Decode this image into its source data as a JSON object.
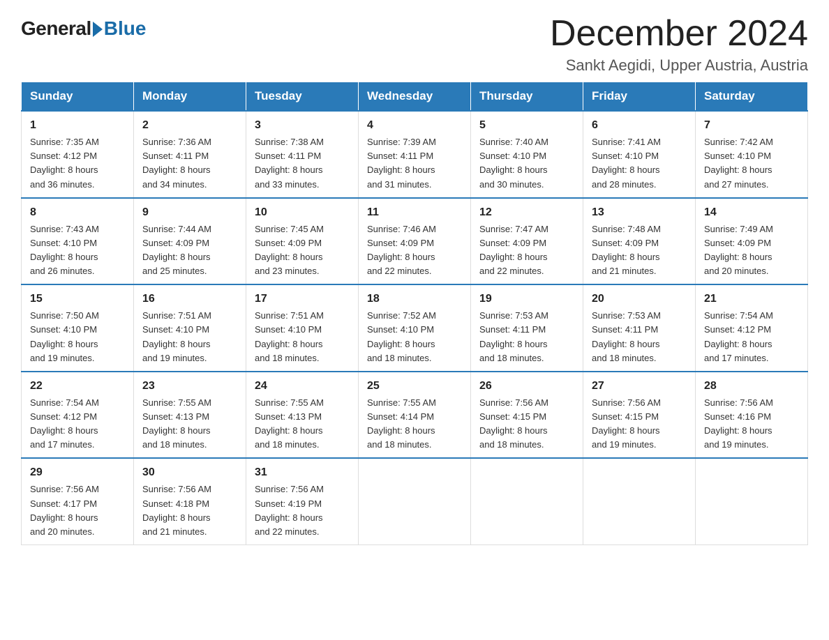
{
  "logo": {
    "general": "General",
    "blue": "Blue"
  },
  "title": "December 2024",
  "subtitle": "Sankt Aegidi, Upper Austria, Austria",
  "days_of_week": [
    "Sunday",
    "Monday",
    "Tuesday",
    "Wednesday",
    "Thursday",
    "Friday",
    "Saturday"
  ],
  "weeks": [
    [
      {
        "day": 1,
        "sunrise": "7:35 AM",
        "sunset": "4:12 PM",
        "daylight": "8 hours and 36 minutes."
      },
      {
        "day": 2,
        "sunrise": "7:36 AM",
        "sunset": "4:11 PM",
        "daylight": "8 hours and 34 minutes."
      },
      {
        "day": 3,
        "sunrise": "7:38 AM",
        "sunset": "4:11 PM",
        "daylight": "8 hours and 33 minutes."
      },
      {
        "day": 4,
        "sunrise": "7:39 AM",
        "sunset": "4:11 PM",
        "daylight": "8 hours and 31 minutes."
      },
      {
        "day": 5,
        "sunrise": "7:40 AM",
        "sunset": "4:10 PM",
        "daylight": "8 hours and 30 minutes."
      },
      {
        "day": 6,
        "sunrise": "7:41 AM",
        "sunset": "4:10 PM",
        "daylight": "8 hours and 28 minutes."
      },
      {
        "day": 7,
        "sunrise": "7:42 AM",
        "sunset": "4:10 PM",
        "daylight": "8 hours and 27 minutes."
      }
    ],
    [
      {
        "day": 8,
        "sunrise": "7:43 AM",
        "sunset": "4:10 PM",
        "daylight": "8 hours and 26 minutes."
      },
      {
        "day": 9,
        "sunrise": "7:44 AM",
        "sunset": "4:09 PM",
        "daylight": "8 hours and 25 minutes."
      },
      {
        "day": 10,
        "sunrise": "7:45 AM",
        "sunset": "4:09 PM",
        "daylight": "8 hours and 23 minutes."
      },
      {
        "day": 11,
        "sunrise": "7:46 AM",
        "sunset": "4:09 PM",
        "daylight": "8 hours and 22 minutes."
      },
      {
        "day": 12,
        "sunrise": "7:47 AM",
        "sunset": "4:09 PM",
        "daylight": "8 hours and 22 minutes."
      },
      {
        "day": 13,
        "sunrise": "7:48 AM",
        "sunset": "4:09 PM",
        "daylight": "8 hours and 21 minutes."
      },
      {
        "day": 14,
        "sunrise": "7:49 AM",
        "sunset": "4:09 PM",
        "daylight": "8 hours and 20 minutes."
      }
    ],
    [
      {
        "day": 15,
        "sunrise": "7:50 AM",
        "sunset": "4:10 PM",
        "daylight": "8 hours and 19 minutes."
      },
      {
        "day": 16,
        "sunrise": "7:51 AM",
        "sunset": "4:10 PM",
        "daylight": "8 hours and 19 minutes."
      },
      {
        "day": 17,
        "sunrise": "7:51 AM",
        "sunset": "4:10 PM",
        "daylight": "8 hours and 18 minutes."
      },
      {
        "day": 18,
        "sunrise": "7:52 AM",
        "sunset": "4:10 PM",
        "daylight": "8 hours and 18 minutes."
      },
      {
        "day": 19,
        "sunrise": "7:53 AM",
        "sunset": "4:11 PM",
        "daylight": "8 hours and 18 minutes."
      },
      {
        "day": 20,
        "sunrise": "7:53 AM",
        "sunset": "4:11 PM",
        "daylight": "8 hours and 18 minutes."
      },
      {
        "day": 21,
        "sunrise": "7:54 AM",
        "sunset": "4:12 PM",
        "daylight": "8 hours and 17 minutes."
      }
    ],
    [
      {
        "day": 22,
        "sunrise": "7:54 AM",
        "sunset": "4:12 PM",
        "daylight": "8 hours and 17 minutes."
      },
      {
        "day": 23,
        "sunrise": "7:55 AM",
        "sunset": "4:13 PM",
        "daylight": "8 hours and 18 minutes."
      },
      {
        "day": 24,
        "sunrise": "7:55 AM",
        "sunset": "4:13 PM",
        "daylight": "8 hours and 18 minutes."
      },
      {
        "day": 25,
        "sunrise": "7:55 AM",
        "sunset": "4:14 PM",
        "daylight": "8 hours and 18 minutes."
      },
      {
        "day": 26,
        "sunrise": "7:56 AM",
        "sunset": "4:15 PM",
        "daylight": "8 hours and 18 minutes."
      },
      {
        "day": 27,
        "sunrise": "7:56 AM",
        "sunset": "4:15 PM",
        "daylight": "8 hours and 19 minutes."
      },
      {
        "day": 28,
        "sunrise": "7:56 AM",
        "sunset": "4:16 PM",
        "daylight": "8 hours and 19 minutes."
      }
    ],
    [
      {
        "day": 29,
        "sunrise": "7:56 AM",
        "sunset": "4:17 PM",
        "daylight": "8 hours and 20 minutes."
      },
      {
        "day": 30,
        "sunrise": "7:56 AM",
        "sunset": "4:18 PM",
        "daylight": "8 hours and 21 minutes."
      },
      {
        "day": 31,
        "sunrise": "7:56 AM",
        "sunset": "4:19 PM",
        "daylight": "8 hours and 22 minutes."
      },
      null,
      null,
      null,
      null
    ]
  ],
  "labels": {
    "sunrise": "Sunrise:",
    "sunset": "Sunset:",
    "daylight": "Daylight:"
  },
  "colors": {
    "header_bg": "#2a7ab8",
    "header_text": "#ffffff",
    "border": "#2a7ab8"
  }
}
